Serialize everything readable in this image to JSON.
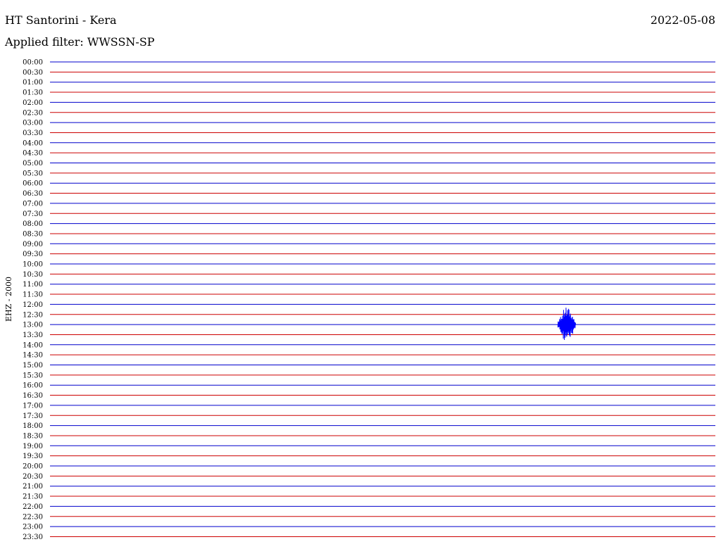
{
  "header": {
    "station": "HT Santorini - Kera",
    "date": "2022-05-08",
    "filter": "Applied filter: WWSSN-SP",
    "channel": "EHZ - 2000"
  },
  "colors": {
    "hour_trace": "#0000cc",
    "half_hour_trace": "#cc0000",
    "event_trace": "#0000ff",
    "text": "#000000"
  },
  "chart_data": {
    "type": "line",
    "title": "HT Santorini - Kera",
    "subtitle": "Applied filter: WWSSN-SP",
    "ylabel": "EHZ - 2000",
    "xlabel": "",
    "rows": [
      "00:00",
      "00:30",
      "01:00",
      "01:30",
      "02:00",
      "02:30",
      "03:00",
      "03:30",
      "04:00",
      "04:30",
      "05:00",
      "05:30",
      "06:00",
      "06:30",
      "07:00",
      "07:30",
      "08:00",
      "08:30",
      "09:00",
      "09:30",
      "10:00",
      "10:30",
      "11:00",
      "11:30",
      "12:00",
      "12:30",
      "13:00",
      "13:30",
      "14:00",
      "14:30",
      "15:00",
      "15:30",
      "16:00",
      "16:30",
      "17:00",
      "17:30",
      "18:00",
      "18:30",
      "19:00",
      "19:30",
      "20:00",
      "20:30",
      "21:00",
      "21:30",
      "22:00",
      "22:30",
      "23:00",
      "23:30"
    ],
    "row_duration_minutes": 30,
    "events": [
      {
        "row": "13:00",
        "start_minute": 22.9,
        "end_minute": 23.7,
        "peak_minute": 23.3,
        "peak_amplitude_rows": 0.85
      }
    ],
    "grid": false,
    "legend": "none"
  }
}
